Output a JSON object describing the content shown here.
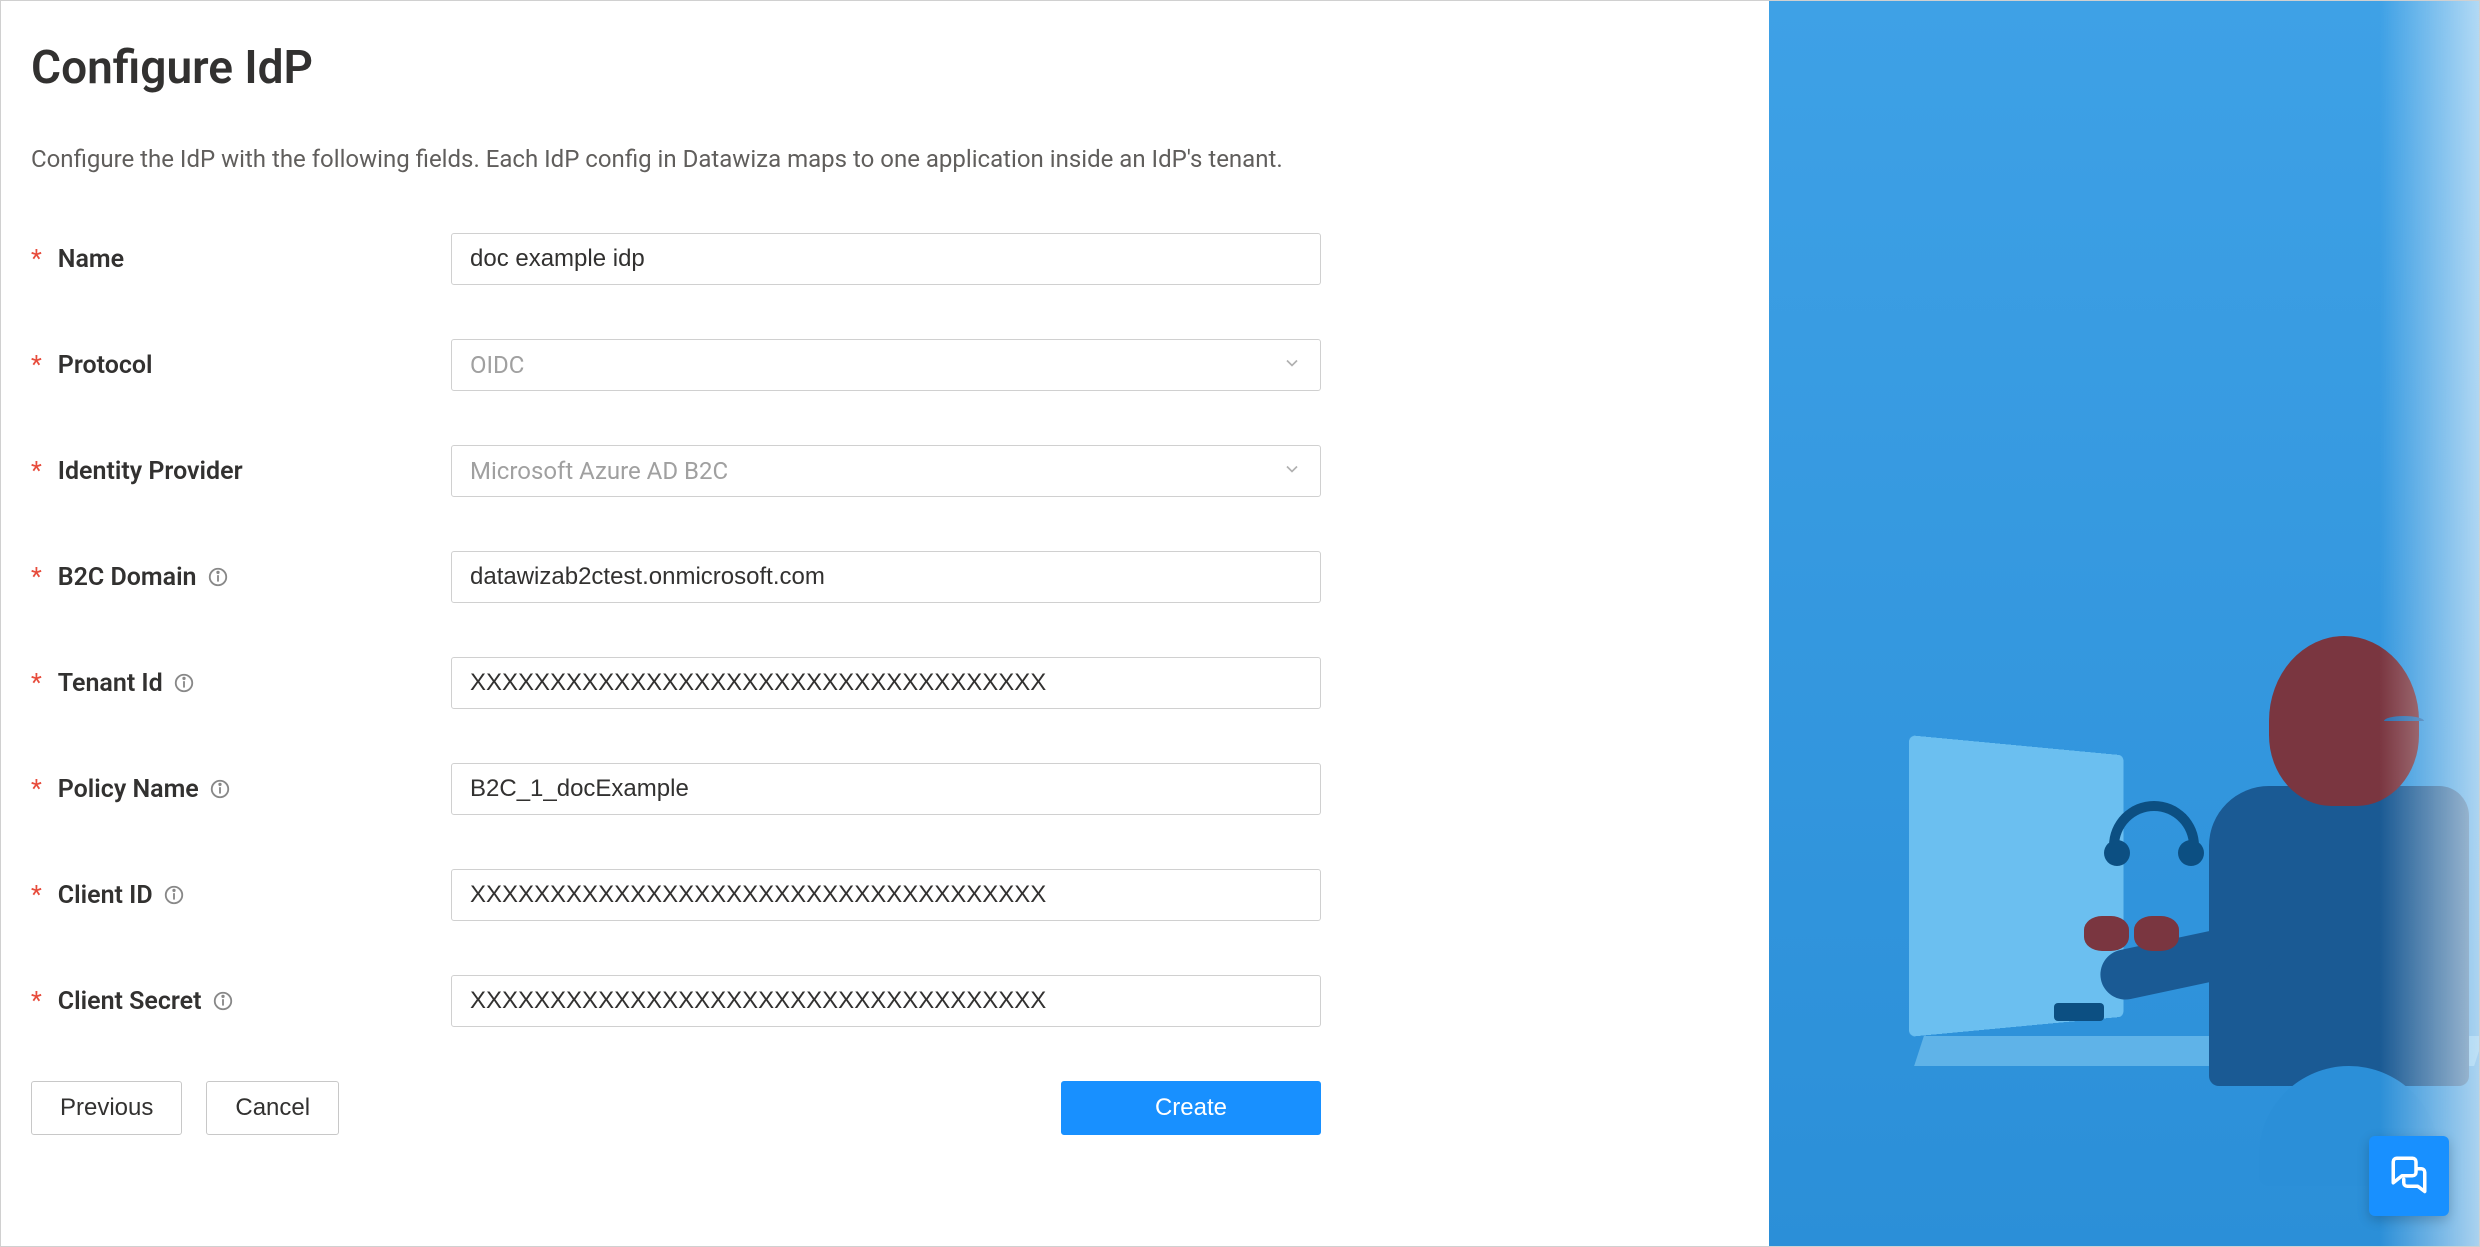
{
  "page": {
    "title": "Configure IdP",
    "description": "Configure the IdP with the following fields. Each IdP config in Datawiza maps to one application inside an IdP's tenant."
  },
  "form": {
    "name": {
      "label": "Name",
      "value": "doc example idp"
    },
    "protocol": {
      "label": "Protocol",
      "value": "OIDC"
    },
    "identity_provider": {
      "label": "Identity Provider",
      "value": "Microsoft Azure AD B2C"
    },
    "b2c_domain": {
      "label": "B2C Domain",
      "value": "datawizab2ctest.onmicrosoft.com"
    },
    "tenant_id": {
      "label": "Tenant Id",
      "value": "XXXXXXXXXXXXXXXXXXXXXXXXXXXXXXXXXXXX"
    },
    "policy_name": {
      "label": "Policy Name",
      "value": "B2C_1_docExample"
    },
    "client_id": {
      "label": "Client ID",
      "value": "XXXXXXXXXXXXXXXXXXXXXXXXXXXXXXXXXXXX"
    },
    "client_secret": {
      "label": "Client Secret",
      "value": "XXXXXXXXXXXXXXXXXXXXXXXXXXXXXXXXXXXX"
    }
  },
  "buttons": {
    "previous": "Previous",
    "cancel": "Cancel",
    "create": "Create"
  }
}
